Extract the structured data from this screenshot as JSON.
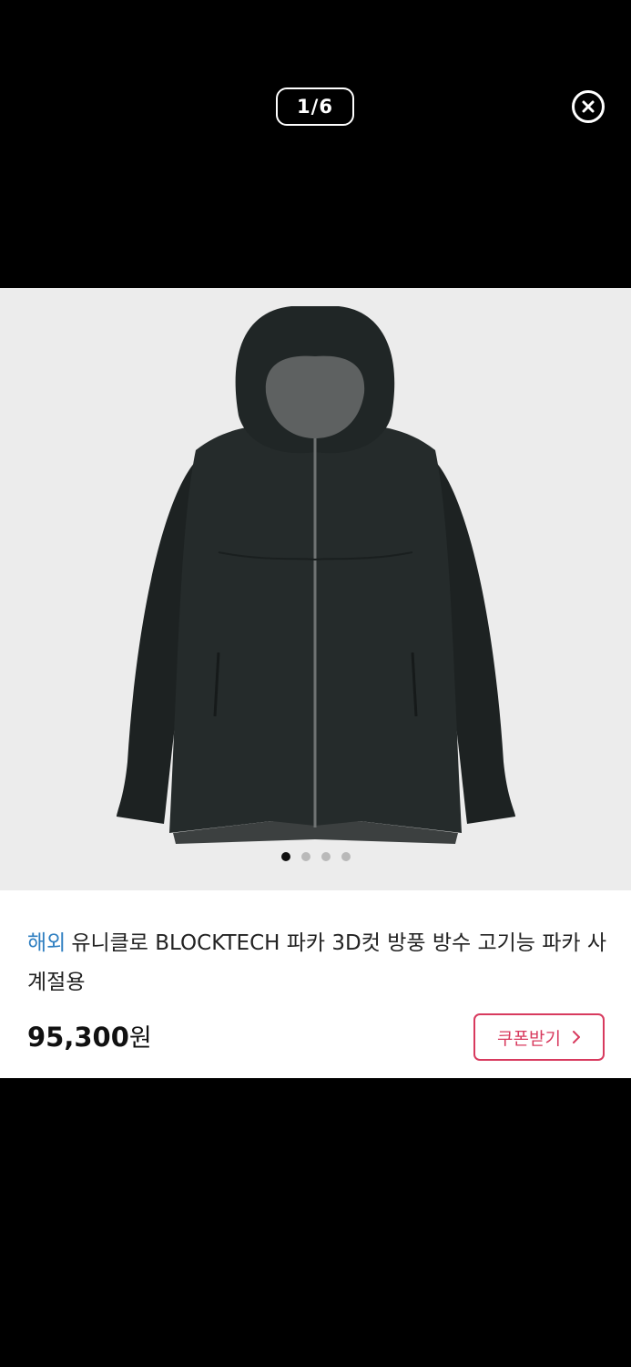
{
  "viewer": {
    "counter": "1/6"
  },
  "gallery": {
    "total_dots": 4,
    "active_dot": 1
  },
  "product": {
    "origin_tag": "해외",
    "title": "유니클로 BLOCKTECH 파카 3D컷 방풍 방수 고기능 파카 사계절용",
    "price_number": "95,300",
    "price_unit": "원",
    "coupon_label": "쿠폰받기"
  },
  "colors": {
    "accent_pink": "#d83a5e",
    "tag_blue": "#2f7fc1"
  },
  "icons": {
    "close": "close-circle-icon",
    "coupon_arrow": "chevron-right-icon"
  }
}
